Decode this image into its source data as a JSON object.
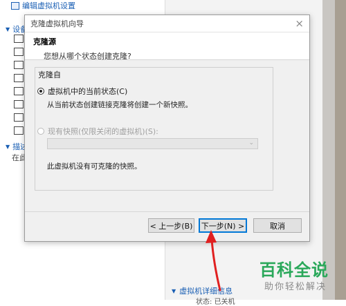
{
  "background": {
    "edit_settings_link": "编辑虚拟机设置",
    "section_devices": "设备",
    "section_description": "描述",
    "description_placeholder": "在此",
    "bottom_section": "虚拟机详细信息",
    "bottom_row_label": "状态:",
    "bottom_row_value": "已关机"
  },
  "dialog": {
    "window_title": "克隆虚拟机向导",
    "close_glyph": "×",
    "header_title": "克隆源",
    "header_subtitle": "您想从哪个状态创建克隆?",
    "group_label": "克隆自",
    "option_current": {
      "label": "虚拟机中的当前状态(C)",
      "description": "从当前状态创建链接克隆将创建一个新快照。",
      "selected": true
    },
    "option_snapshot": {
      "label": "现有快照(仅限关闭的虚拟机)(S):",
      "enabled": false,
      "dropdown_value": "",
      "note": "此虚拟机没有可克隆的快照。"
    },
    "buttons": {
      "back": "< 上一步(B)",
      "next": "下一步(N) >",
      "cancel": "取消"
    }
  },
  "watermark": {
    "title": "百科全说",
    "subtitle": "助你轻松解决"
  },
  "colors": {
    "accent_blue": "#1a5fb4",
    "focus_blue": "#0078d7",
    "watermark_green": "#2aa85a",
    "annotation_red": "#e02020"
  },
  "icons": [
    "pencil-icon",
    "expand-triangle-icon",
    "device-icon",
    "chevron-down-icon",
    "close-icon"
  ]
}
